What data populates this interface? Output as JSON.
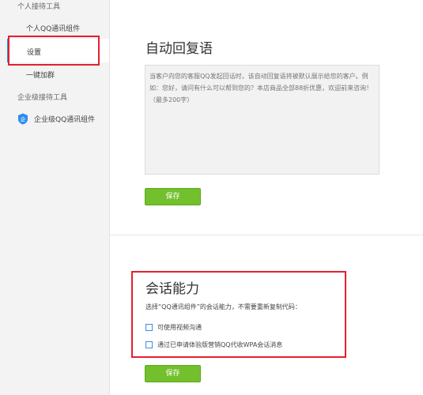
{
  "sidebar": {
    "section_personal": "个人接待工具",
    "item_qq_component": "个人QQ通讯组件",
    "item_settings": "设置",
    "item_join_group": "一键加群",
    "section_enterprise": "企业级接待工具",
    "item_enterprise_qq": "企业级QQ通讯组件",
    "accent_color": "#2d8cf0"
  },
  "auto_reply": {
    "title": "自动回复语",
    "placeholder": "当客户向您的客服QQ发起回话时，该自动回复语将被默认展示给您的客户。例如：您好，请问有什么可以帮到您的？本店商品全部88折优惠，欢迎前来咨询！（最多200字）",
    "save_label": "保存"
  },
  "session": {
    "title": "会话能力",
    "description": "选择“QQ通讯组件”的会话能力，不需要重新复制代码：",
    "options": [
      {
        "label": "可使用视频沟通",
        "checked": false
      },
      {
        "label": "通过已申请体验版营销QQ代收WPA会话消息",
        "checked": false
      }
    ],
    "save_label": "保存"
  },
  "colors": {
    "save_button": "#72c02c",
    "highlight_border": "#e5202c"
  }
}
